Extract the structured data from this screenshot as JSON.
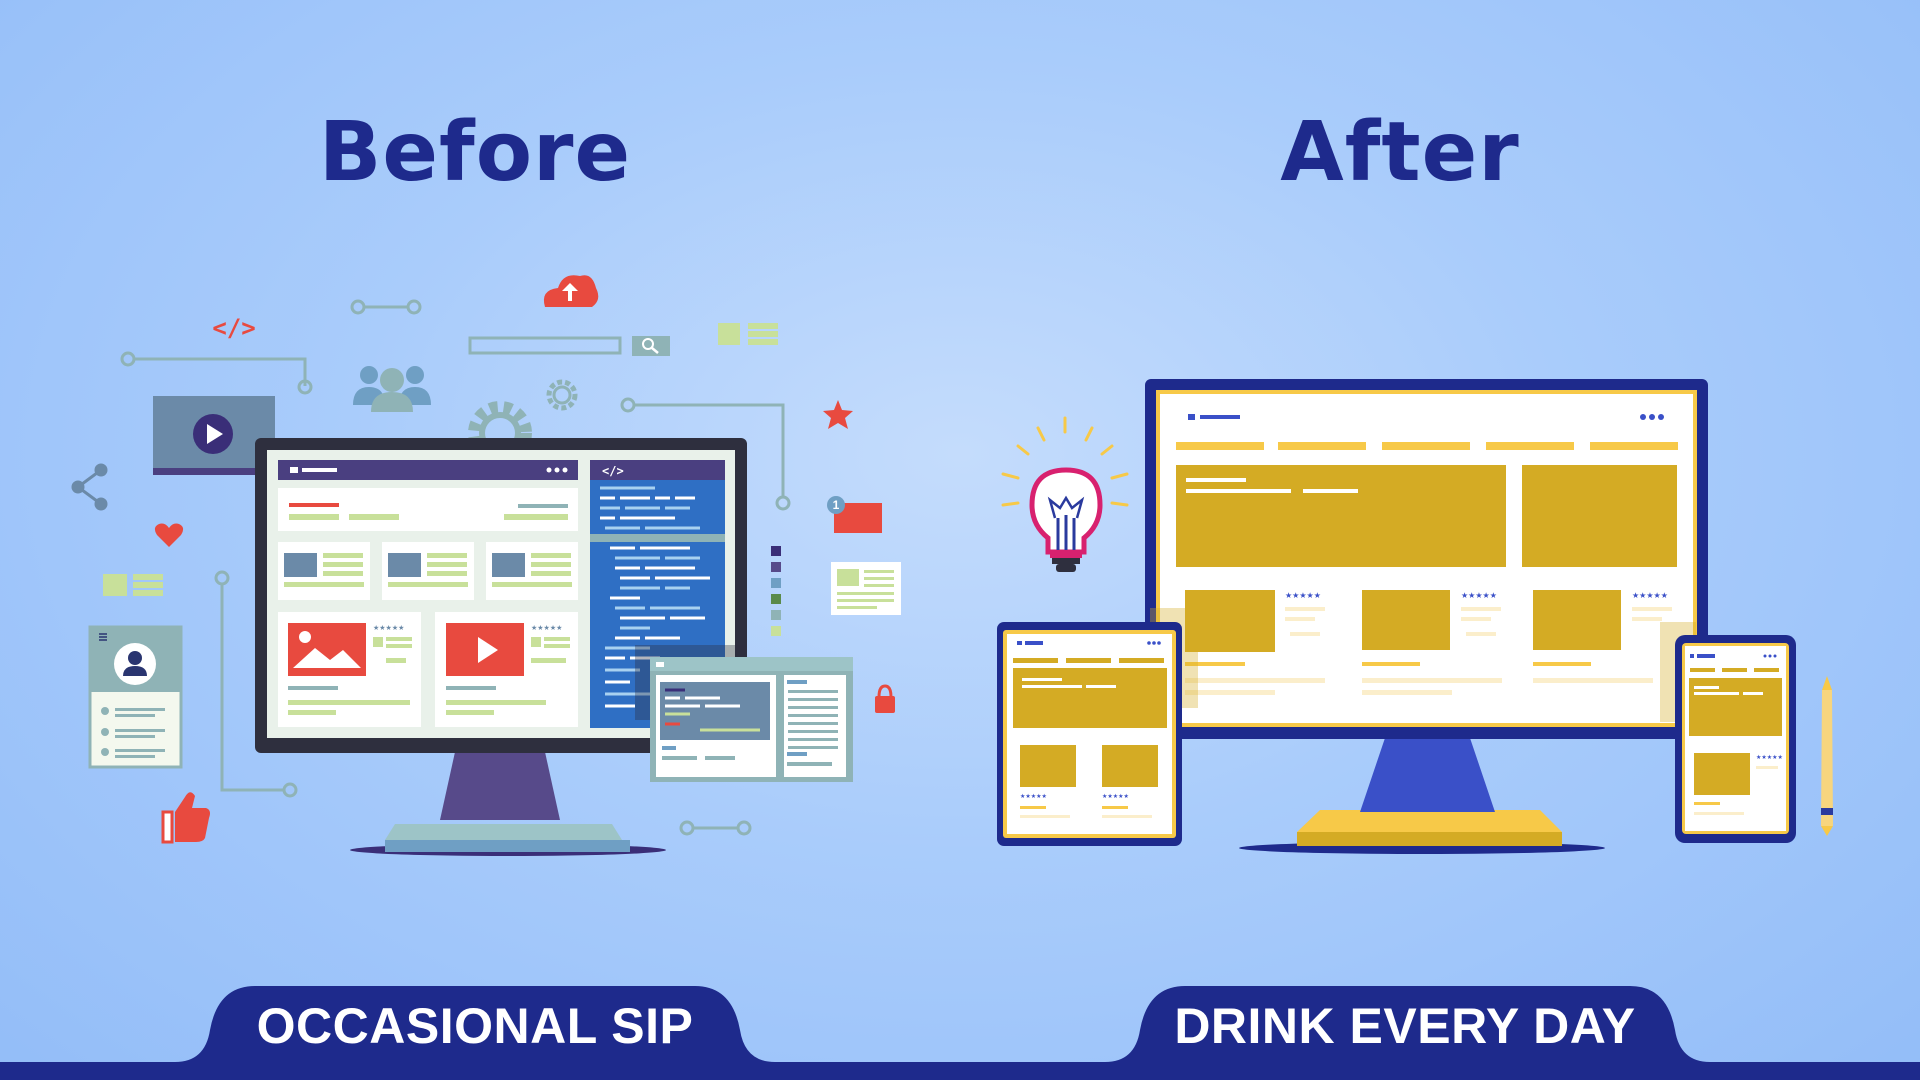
{
  "headings": {
    "before": "Before",
    "after": "After"
  },
  "labels": {
    "left": "OCCASIONAL SIP",
    "right": "DRINK EVERY DAY"
  },
  "before_scene": {
    "code_tag": "</>",
    "code_panel_tag": "</>",
    "notification_count": "1",
    "rating_stars": "★★★★★"
  },
  "after_scene": {
    "rating_stars": "★★★★★"
  },
  "colors": {
    "navy": "#1e2a8c",
    "accent_gold": "#d4ab24",
    "accent_red": "#e84a3f",
    "monitor_purple": "#574a8a",
    "code_blue": "#2f6fc4"
  },
  "icons": [
    "play-icon",
    "share-icon",
    "heart-icon",
    "thumbs-up-icon",
    "users-icon",
    "gear-icon",
    "cloud-upload-icon",
    "search-icon",
    "star-icon",
    "lock-icon",
    "lightbulb-icon",
    "pencil-icon",
    "image-icon",
    "user-avatar-icon"
  ]
}
